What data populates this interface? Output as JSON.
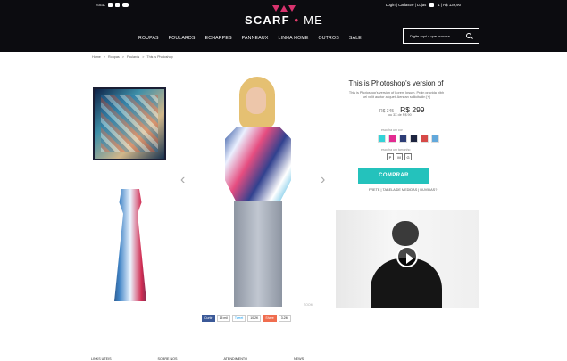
{
  "header": {
    "social_label": "SIGA",
    "account_label": "Login | Cadastre | Lojas",
    "cart_label": "1 | R$ 139,90",
    "logo_left": "SCARF",
    "logo_dot": "•",
    "logo_right": "ME",
    "search_placeholder": "Digite aqui o que procura",
    "nav": [
      "ROUPAS",
      "FOULARDS",
      "ECHARPES",
      "PANNEAUX",
      "LINHA HOME",
      "OUTROS",
      "SALE"
    ]
  },
  "breadcrumb": [
    "Home",
    ">",
    "Roupas",
    ">",
    "Foulards",
    ">",
    "This is Photoshop"
  ],
  "product": {
    "title": "This is Photoshop's version  of",
    "description": "This is Photoshop's version  of Lorem Ipsum. Proin gravida nibh vel velit auctor aliquet. Aenean sollicitudin [+]",
    "old_price": "R$ 345",
    "new_price": "R$ 299",
    "installments": "ou 3X de R$ 90",
    "color_label": "escolha um cor",
    "size_label": "escolha um tamanho",
    "sizes": [
      "P",
      "M",
      "G"
    ],
    "buy_label": "COMPRAR",
    "links": "FRETE  |  TABELA DE MEDIDAS  |  DUVIDAS?",
    "zoom_label": "ZOOM"
  },
  "share": {
    "facebook": "Curtir",
    "facebook_count": "15 mil",
    "twitter": "Tweet",
    "twitter_count": "10.2K",
    "share": "Share",
    "share_count": "3.2M"
  },
  "colors": [
    "#33d3d8",
    "#e32b91",
    "#2d3d76",
    "#1d243f",
    "#d64a48",
    "#62a8db"
  ],
  "footer": [
    "LINKS UTEIS",
    "SOBRE NOS",
    "ATENDIMENTO",
    "NEWS"
  ]
}
